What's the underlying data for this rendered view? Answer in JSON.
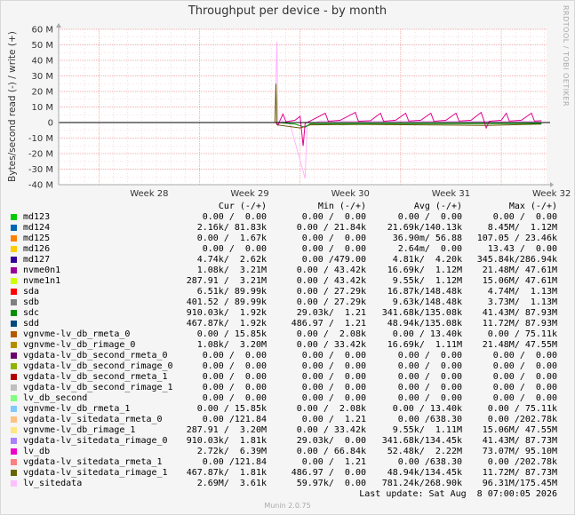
{
  "title": "Throughput per device - by month",
  "side_text": "RRDTOOL / TOBI OETIKER",
  "footer": "Munin 2.0.75",
  "last_update": "Last update: Sat Aug  8 07:00:05 2026",
  "colors": {
    "grid_major": "#ff8080",
    "grid_minor": "#ff9999",
    "axis": "#000000"
  },
  "table_header": {
    "cur": "Cur (-/+)",
    "min": "Min (-/+)",
    "avg": "Avg (-/+)",
    "max": "Max (-/+)"
  },
  "chart_data": {
    "type": "line",
    "ylabel": "Bytes/second read (-) / write (+)",
    "ylim": [
      -40000000,
      60000000
    ],
    "yticks": [
      60000000,
      50000000,
      40000000,
      30000000,
      20000000,
      10000000,
      0,
      -10000000,
      -20000000,
      -30000000,
      -40000000
    ],
    "ytick_labels": [
      "60 M",
      "50 M",
      "40 M",
      "30 M",
      "20 M",
      "10 M",
      "0",
      "-10 M",
      "-20 M",
      "-30 M",
      "-40 M"
    ],
    "x_range_weeks": [
      27.6,
      32.45
    ],
    "xticks": [
      28,
      29,
      30,
      31,
      32
    ],
    "xtick_labels": [
      "Week 28",
      "Week 29",
      "Week 30",
      "Week 31",
      "Week 32"
    ],
    "grid": true,
    "series": [
      {
        "name": "lv_sitedata",
        "color": "#ffb3ff",
        "points": [
          [
            29.75,
            0
          ],
          [
            29.77,
            52000000
          ],
          [
            29.78,
            -2000000
          ],
          [
            29.82,
            1200000
          ],
          [
            29.9,
            -1000000
          ],
          [
            30.05,
            -36000000
          ],
          [
            30.07,
            -2000000
          ],
          [
            30.2,
            1000000
          ],
          [
            32.4,
            800000
          ]
        ]
      },
      {
        "name": "vgdata-lv_sitedata_rimage_1",
        "color": "#665500",
        "points": [
          [
            29.75,
            0
          ],
          [
            29.76,
            25000000
          ],
          [
            29.77,
            -1500000
          ],
          [
            30.0,
            -3500000
          ],
          [
            30.1,
            -1500000
          ],
          [
            30.6,
            -1200000
          ],
          [
            31.85,
            -1800000
          ],
          [
            32.4,
            -1000000
          ]
        ]
      },
      {
        "name": "sdc",
        "color": "#009900",
        "points": [
          [
            29.78,
            0
          ],
          [
            29.95,
            -1000000
          ],
          [
            30.05,
            -3000000
          ],
          [
            30.1,
            -800000
          ],
          [
            32.4,
            -600000
          ]
        ]
      },
      {
        "name": "lv_db",
        "color": "#e00090",
        "points": [
          [
            29.76,
            0
          ],
          [
            29.78,
            -1500000
          ],
          [
            29.83,
            5500000
          ],
          [
            29.86,
            500000
          ],
          [
            29.95,
            1500000
          ],
          [
            30.0,
            4000000
          ],
          [
            30.03,
            -15000000
          ],
          [
            30.05,
            -500000
          ],
          [
            30.1,
            1000000
          ],
          [
            30.25,
            6000000
          ],
          [
            30.28,
            800000
          ],
          [
            30.4,
            1500000
          ],
          [
            30.55,
            6500000
          ],
          [
            30.58,
            800000
          ],
          [
            30.7,
            1200000
          ],
          [
            30.8,
            6000000
          ],
          [
            30.83,
            800000
          ],
          [
            30.95,
            1500000
          ],
          [
            31.05,
            6000000
          ],
          [
            31.08,
            900000
          ],
          [
            31.2,
            1500000
          ],
          [
            31.3,
            6000000
          ],
          [
            31.33,
            800000
          ],
          [
            31.45,
            1500000
          ],
          [
            31.55,
            6000000
          ],
          [
            31.58,
            900000
          ],
          [
            31.7,
            1500000
          ],
          [
            31.8,
            6500000
          ],
          [
            31.83,
            800000
          ],
          [
            31.85,
            -3500000
          ],
          [
            31.88,
            800000
          ],
          [
            32.0,
            1500000
          ],
          [
            32.05,
            6000000
          ],
          [
            32.08,
            900000
          ],
          [
            32.2,
            1500000
          ],
          [
            32.3,
            6000000
          ],
          [
            32.33,
            900000
          ],
          [
            32.4,
            1200000
          ]
        ]
      },
      {
        "name": "md124",
        "color": "#0066b3",
        "points": [
          [
            27.6,
            0
          ],
          [
            32.45,
            0
          ]
        ]
      }
    ]
  },
  "legend": [
    {
      "name": "md123",
      "color": "#00cc00",
      "cur": "0.00 /  0.00",
      "min": "0.00 /  0.00",
      "avg": "0.00 /  0.00",
      "max": "0.00 /  0.00"
    },
    {
      "name": "md124",
      "color": "#0066b3",
      "cur": "2.16k/ 81.83k",
      "min": "0.00 / 21.84k",
      "avg": "21.69k/140.13k",
      "max": "8.45M/  1.12M"
    },
    {
      "name": "md125",
      "color": "#ff8000",
      "cur": "0.00 /  1.67k",
      "min": "0.00 /  0.00",
      "avg": "36.90m/ 56.88",
      "max": "107.05 / 23.46k"
    },
    {
      "name": "md126",
      "color": "#ffcc00",
      "cur": "0.00 /  0.00",
      "min": "0.00 /  0.00",
      "avg": "2.64m/  0.00",
      "max": "13.43 /  0.00"
    },
    {
      "name": "md127",
      "color": "#330099",
      "cur": "4.74k/  2.62k",
      "min": "0.00 /479.00",
      "avg": "4.81k/  4.20k",
      "max": "345.84k/286.94k"
    },
    {
      "name": "nvme0n1",
      "color": "#990099",
      "cur": "1.08k/  3.21M",
      "min": "0.00 / 43.42k",
      "avg": "16.69k/  1.12M",
      "max": "21.48M/ 47.61M"
    },
    {
      "name": "nvme1n1",
      "color": "#ccff00",
      "cur": "287.91 /  3.21M",
      "min": "0.00 / 43.42k",
      "avg": "9.55k/  1.12M",
      "max": "15.06M/ 47.61M"
    },
    {
      "name": "sda",
      "color": "#ff0000",
      "cur": "6.51k/ 89.99k",
      "min": "0.00 / 27.29k",
      "avg": "16.87k/148.48k",
      "max": "4.74M/  1.13M"
    },
    {
      "name": "sdb",
      "color": "#808080",
      "cur": "401.52 / 89.99k",
      "min": "0.00 / 27.29k",
      "avg": "9.63k/148.48k",
      "max": "3.73M/  1.13M"
    },
    {
      "name": "sdc",
      "color": "#008f00",
      "cur": "910.03k/  1.92k",
      "min": "29.03k/  1.21",
      "avg": "341.68k/135.08k",
      "max": "41.43M/ 87.93M"
    },
    {
      "name": "sdd",
      "color": "#00487d",
      "cur": "467.87k/  1.92k",
      "min": "486.97 /  1.21",
      "avg": "48.94k/135.08k",
      "max": "11.72M/ 87.93M"
    },
    {
      "name": "vgnvme-lv_db_rmeta_0",
      "color": "#b35a00",
      "cur": "0.00 / 15.85k",
      "min": "0.00 /  2.08k",
      "avg": "0.00 / 13.40k",
      "max": "0.00 / 75.11k"
    },
    {
      "name": "vgnvme-lv_db_rimage_0",
      "color": "#b38f00",
      "cur": "1.08k/  3.20M",
      "min": "0.00 / 33.42k",
      "avg": "16.69k/  1.11M",
      "max": "21.48M/ 47.55M"
    },
    {
      "name": "vgdata-lv_db_second_rmeta_0",
      "color": "#6b006b",
      "cur": "0.00 /  0.00",
      "min": "0.00 /  0.00",
      "avg": "0.00 /  0.00",
      "max": "0.00 /  0.00"
    },
    {
      "name": "vgdata-lv_db_second_rimage_0",
      "color": "#8fb300",
      "cur": "0.00 /  0.00",
      "min": "0.00 /  0.00",
      "avg": "0.00 /  0.00",
      "max": "0.00 /  0.00"
    },
    {
      "name": "vgdata-lv_db_second_rmeta_1",
      "color": "#b30000",
      "cur": "0.00 /  0.00",
      "min": "0.00 /  0.00",
      "avg": "0.00 /  0.00",
      "max": "0.00 /  0.00"
    },
    {
      "name": "vgdata-lv_db_second_rimage_1",
      "color": "#bebebe",
      "cur": "0.00 /  0.00",
      "min": "0.00 /  0.00",
      "avg": "0.00 /  0.00",
      "max": "0.00 /  0.00"
    },
    {
      "name": "lv_db_second",
      "color": "#80ff80",
      "cur": "0.00 /  0.00",
      "min": "0.00 /  0.00",
      "avg": "0.00 /  0.00",
      "max": "0.00 /  0.00"
    },
    {
      "name": "vgnvme-lv_db_rmeta_1",
      "color": "#80c9ff",
      "cur": "0.00 / 15.85k",
      "min": "0.00 /  2.08k",
      "avg": "0.00 / 13.40k",
      "max": "0.00 / 75.11k"
    },
    {
      "name": "vgdata-lv_sitedata_rmeta_0",
      "color": "#ffc080",
      "cur": "0.00 /121.84",
      "min": "0.00 /  1.21",
      "avg": "0.00 /638.30",
      "max": "0.00 /202.78k"
    },
    {
      "name": "vgnvme-lv_db_rimage_1",
      "color": "#ffe680",
      "cur": "287.91 /  3.20M",
      "min": "0.00 / 33.42k",
      "avg": "9.55k/  1.11M",
      "max": "15.06M/ 47.55M"
    },
    {
      "name": "vgdata-lv_sitedata_rimage_0",
      "color": "#aa80ff",
      "cur": "910.03k/  1.81k",
      "min": "29.03k/  0.00",
      "avg": "341.68k/134.45k",
      "max": "41.43M/ 87.73M"
    },
    {
      "name": "lv_db",
      "color": "#ee00cc",
      "cur": "2.72k/  6.39M",
      "min": "0.00 / 66.84k",
      "avg": "52.48k/  2.22M",
      "max": "73.07M/ 95.10M"
    },
    {
      "name": "vgdata-lv_sitedata_rmeta_1",
      "color": "#ff8080",
      "cur": "0.00 /121.84",
      "min": "0.00 /  1.21",
      "avg": "0.00 /638.30",
      "max": "0.00 /202.78k"
    },
    {
      "name": "vgdata-lv_sitedata_rimage_1",
      "color": "#666600",
      "cur": "467.87k/  1.81k",
      "min": "486.97 /  0.00",
      "avg": "48.94k/134.45k",
      "max": "11.72M/ 87.73M"
    },
    {
      "name": "lv_sitedata",
      "color": "#ffbfff",
      "cur": "2.69M/  3.61k",
      "min": "59.97k/  0.00",
      "avg": "781.24k/268.90k",
      "max": "96.31M/175.45M"
    }
  ]
}
